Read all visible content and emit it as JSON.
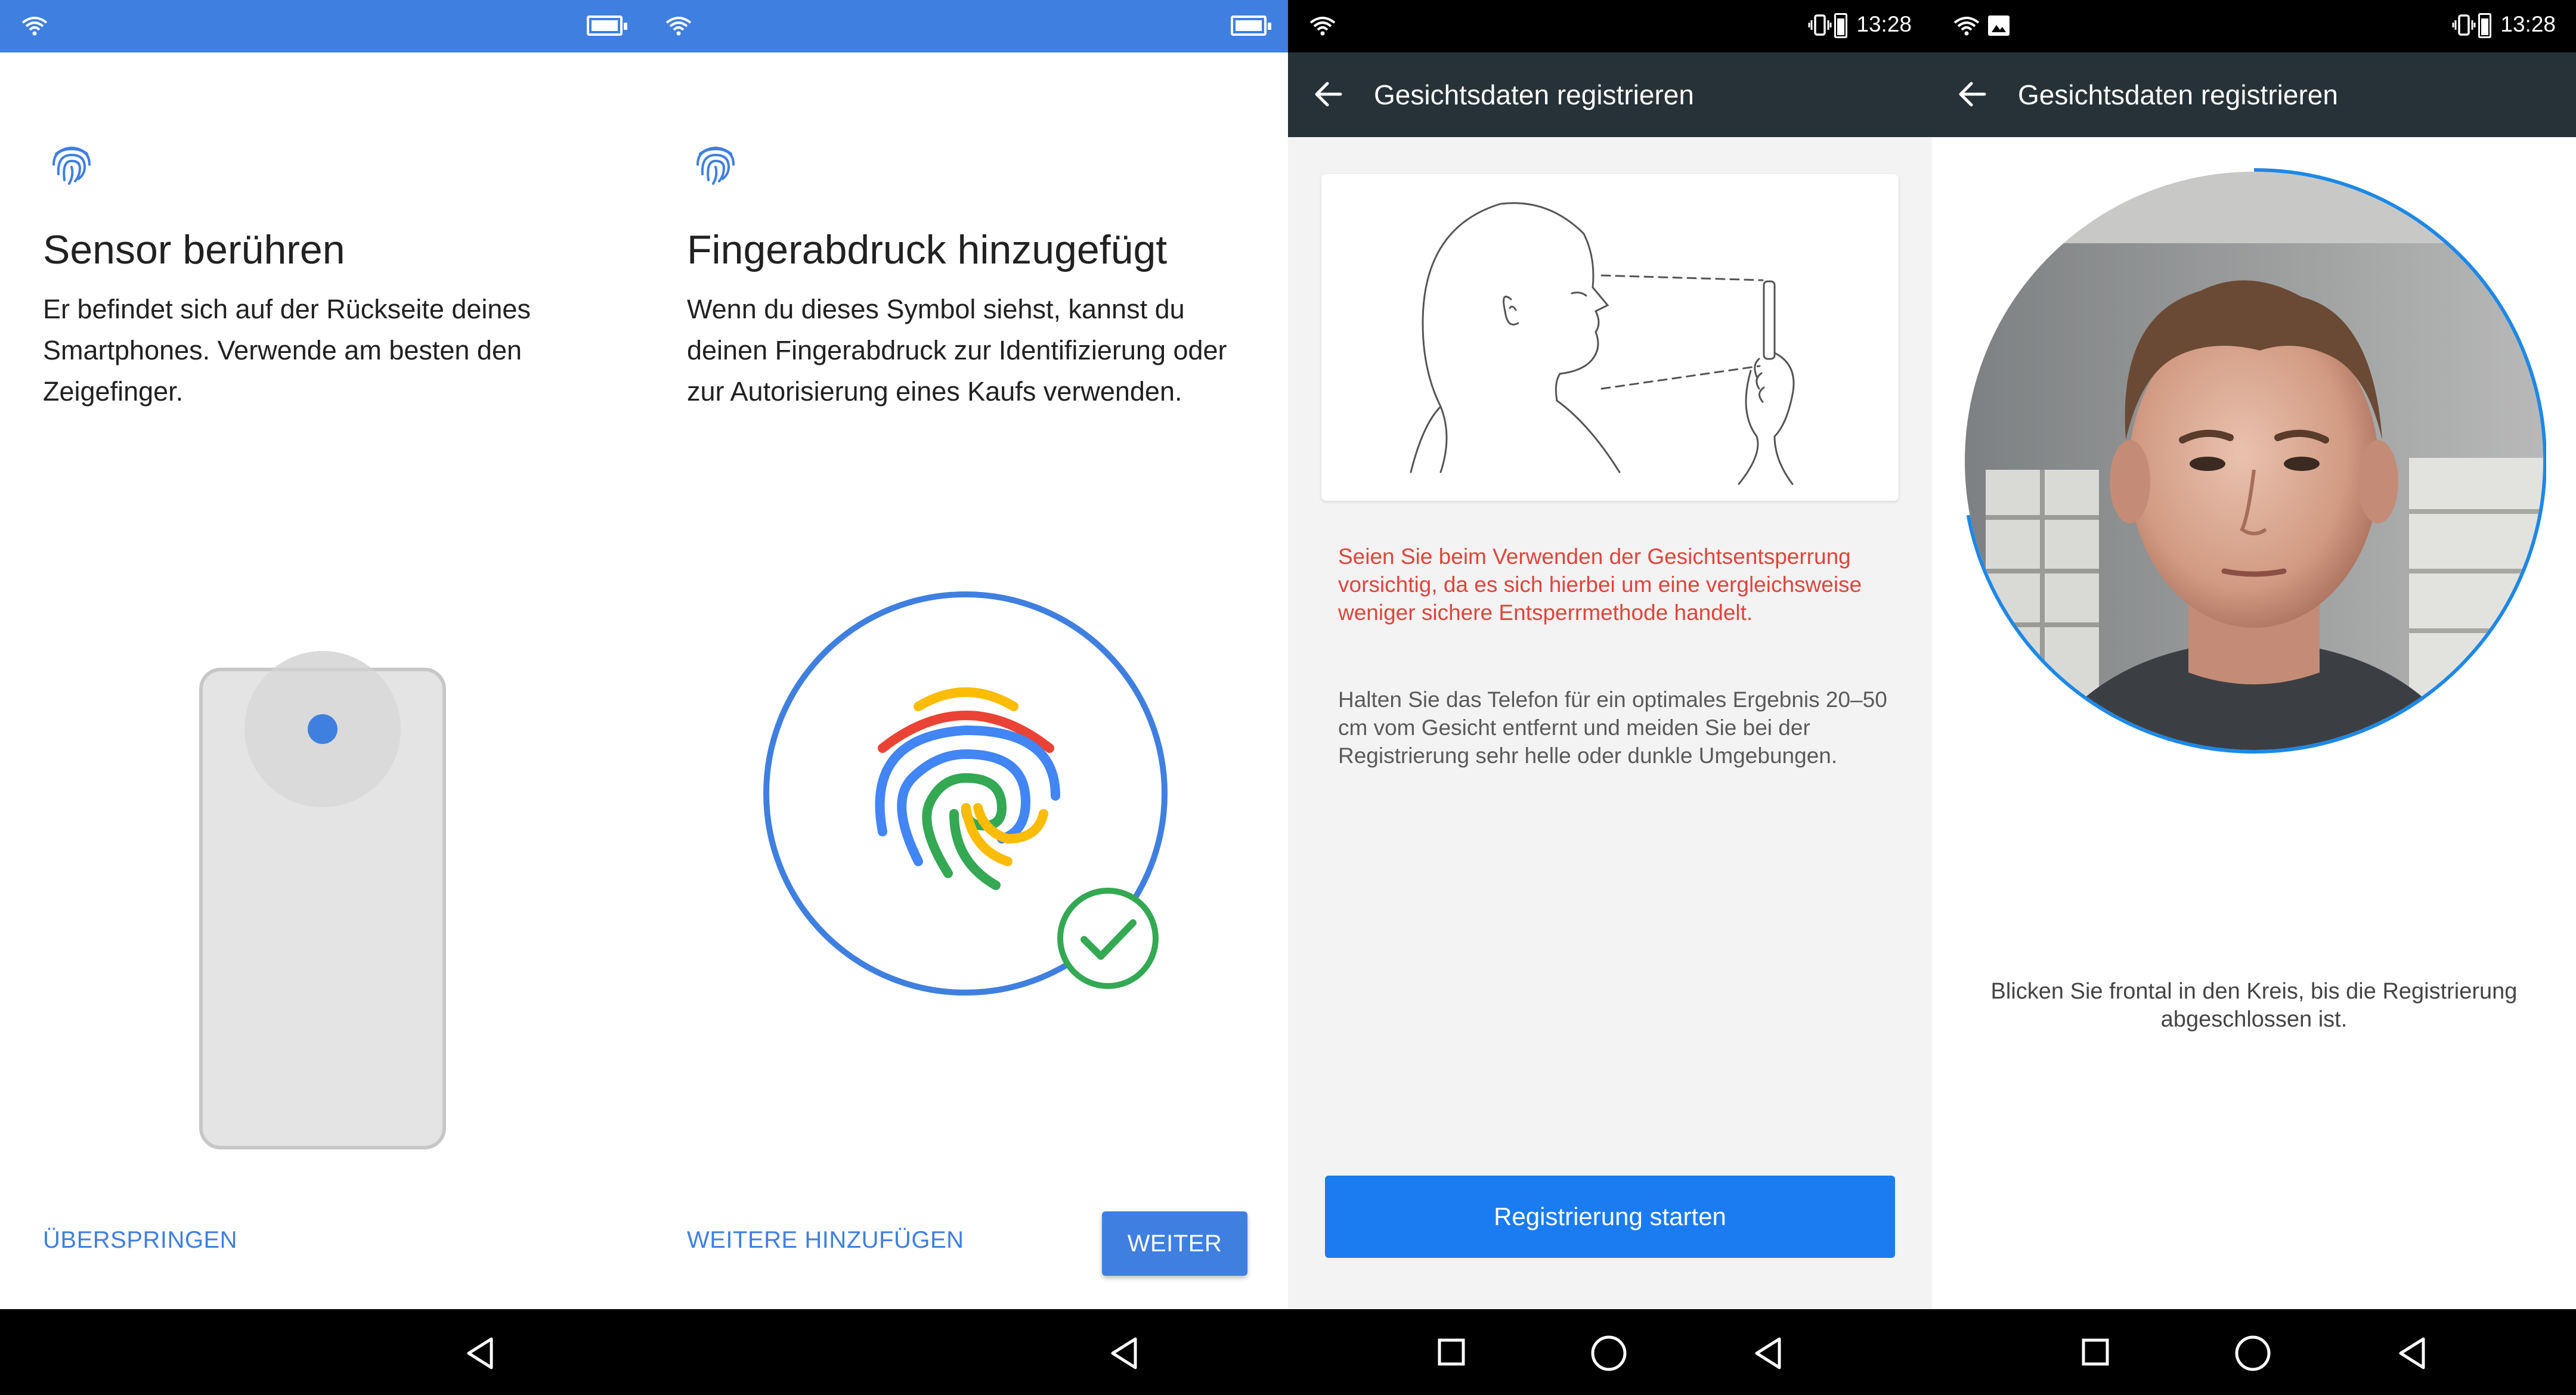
{
  "colors": {
    "accent": "#3f7fe0",
    "warning": "#e0443c",
    "appbar": "#263238",
    "register_button": "#1a7cf0",
    "check_green": "#34a853"
  },
  "panel1": {
    "title": "Sensor berühren",
    "body": "Er befindet sich auf der Rückseite deines Smartphones. Verwende am besten den Zeigefinger.",
    "skip_label": "ÜBERSPRINGEN"
  },
  "panel2": {
    "title": "Fingerabdruck hinzugefügt",
    "body": "Wenn du dieses Symbol siehst, kannst du deinen Fingerabdruck zur Identifizierung oder zur Autorisierung eines Kaufs verwenden.",
    "add_more_label": "WEITERE HINZUFÜGEN",
    "next_label": "WEITER"
  },
  "panel3": {
    "time": "13:28",
    "appbar_title": "Gesichtsdaten registrieren",
    "warning": "Seien Sie beim Verwenden der Gesichtsentsperrung vorsichtig, da es sich hierbei um eine vergleichsweise weniger sichere Entsperrmethode handelt.",
    "info": "Halten Sie das Telefon für ein optimales Ergebnis 20–50 cm vom Gesicht entfernt und meiden Sie bei der Registrierung sehr helle oder dunkle Umgebungen.",
    "register_label": "Registrierung starten"
  },
  "panel4": {
    "time": "13:28",
    "appbar_title": "Gesichtsdaten registrieren",
    "instruction": "Blicken Sie frontal in den Kreis, bis die Registrierung abgeschlossen ist.",
    "progress": 0.72
  },
  "icons": {
    "wifi": "wifi-icon",
    "battery": "battery-icon",
    "vibrate": "vibrate-icon",
    "image": "image-notification-icon",
    "back": "arrow-back-icon",
    "fingerprint": "fingerprint-icon",
    "check": "check-circle-icon",
    "nav_back": "nav-back-icon",
    "nav_home": "nav-home-icon",
    "nav_recents": "nav-recents-icon"
  }
}
